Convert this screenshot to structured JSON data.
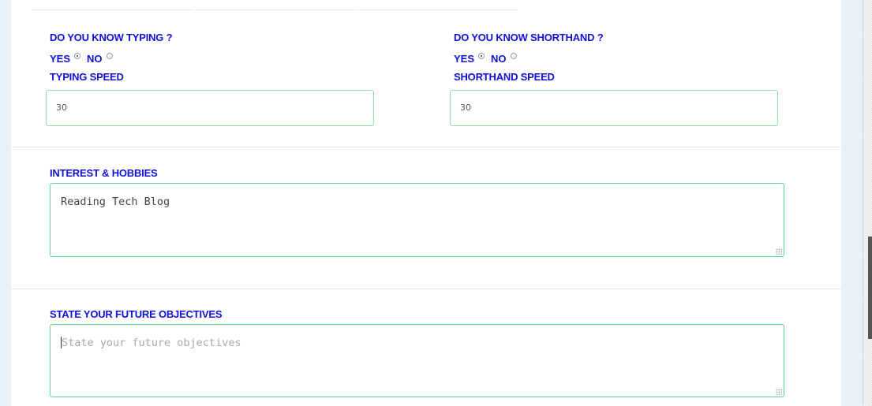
{
  "typing": {
    "question": "DO YOU KNOW TYPING ?",
    "yes_label": "YES",
    "no_label": "NO",
    "selected": "YES",
    "speed_label": "TYPING SPEED",
    "speed_value": "30"
  },
  "shorthand": {
    "question": "DO YOU KNOW SHORTHAND ?",
    "yes_label": "YES",
    "no_label": "NO",
    "selected": "YES",
    "speed_label": "SHORTHAND SPEED",
    "speed_value": "30"
  },
  "hobbies": {
    "label": "INTEREST & HOBBIES",
    "value": "Reading Tech Blog"
  },
  "objectives": {
    "label": "STATE YOUR FUTURE OBJECTIVES",
    "placeholder": "State your future objectives",
    "value": ""
  },
  "colors": {
    "label": "#1010d8",
    "input_border": "#8fe0a8",
    "textarea_border": "#5fd885",
    "page_background": "#e8f0f8"
  }
}
